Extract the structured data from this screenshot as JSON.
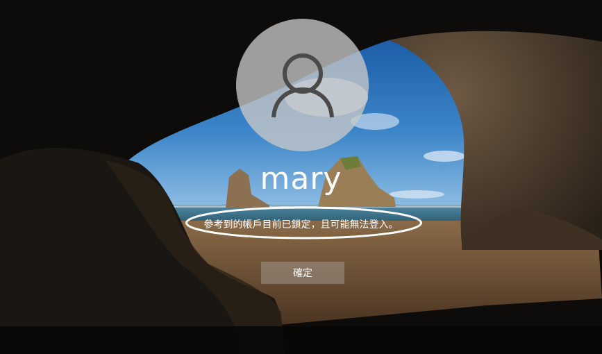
{
  "user": {
    "name": "mary",
    "avatar_icon": "user-icon"
  },
  "lock_message": "參考到的帳戶目前已鎖定，且可能無法登入。",
  "ok_button_label": "確定",
  "colors": {
    "text": "#ffffff",
    "annotation_ellipse": "#ffffff",
    "button_bg": "#8f8478"
  }
}
